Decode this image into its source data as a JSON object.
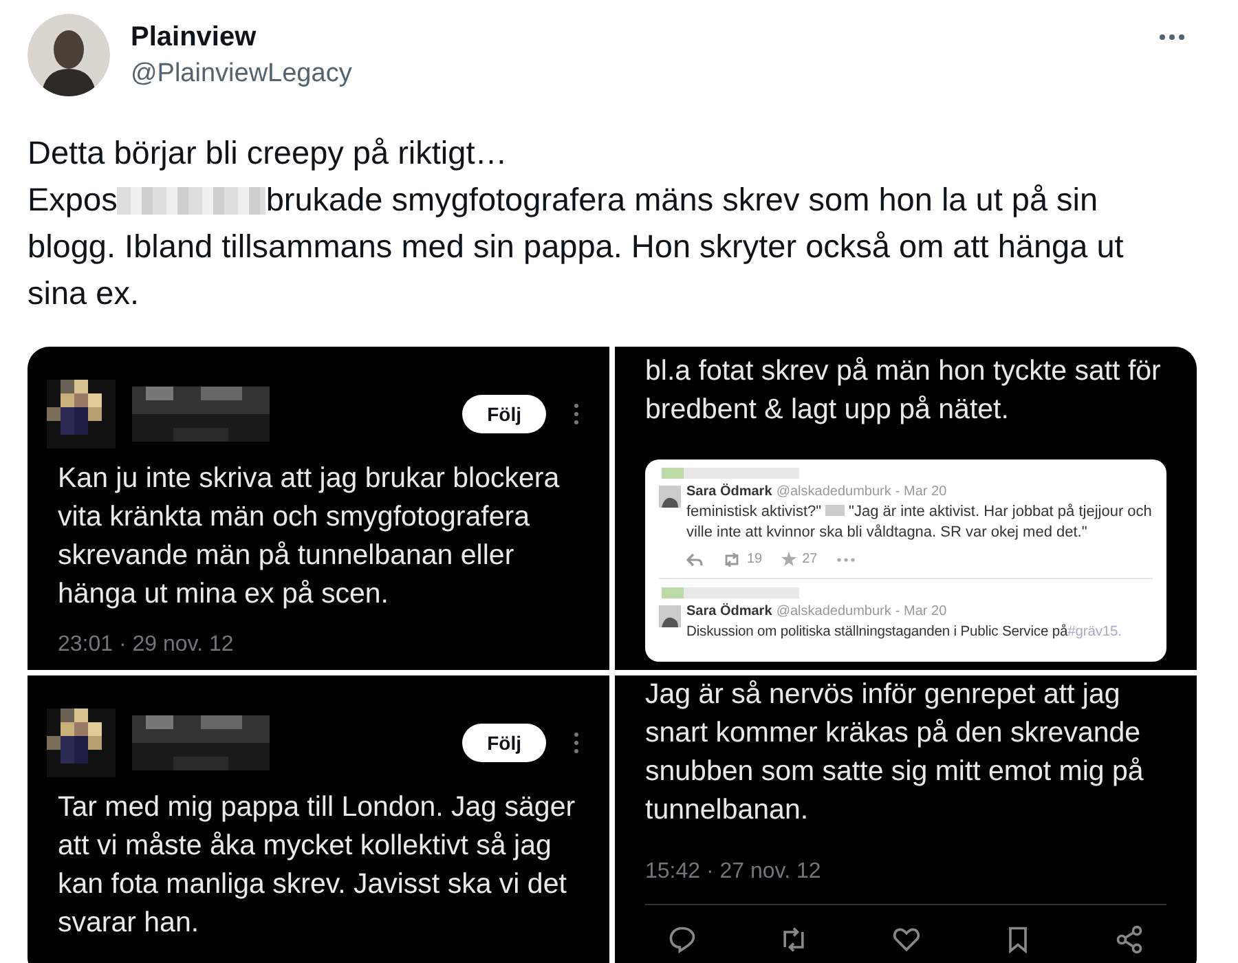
{
  "author": {
    "name": "Plainview",
    "handle": "@PlainviewLegacy"
  },
  "body": {
    "line_1": "Detta börjar bli creepy på riktigt…",
    "before_redaction": "Expos",
    "after_redaction": "brukade smygfotografera mäns skrev som hon la ut på sin blogg. Ibland tillsammans med sin pappa. Hon skryter också om att hänga ut sina ex."
  },
  "media": [
    {
      "follow": "Följ",
      "text": "Kan ju inte skriva att jag brukar blockera vita kränkta män och smygfotografera skrevande män på tunnelbanan eller hänga ut mina ex på scen.",
      "time": "23:01 · 29 nov. 12"
    },
    {
      "text": "bl.a fotat skrev på män hon tyckte satt för bredbent & lagt upp på nätet.",
      "embedded": [
        {
          "name": "Sara Ödmark",
          "handle": "@alskadedumburk",
          "date": "- Mar 20",
          "text_before": "feministisk aktivist?\"",
          "text_after": "\"Jag är inte aktivist. Har jobbat på tjejjour och ville inte att kvinnor ska bli våldtagna. SR var okej med det.\"",
          "retweets": "19",
          "favorites": "27"
        },
        {
          "name": "Sara Ödmark",
          "handle": "@alskadedumburk",
          "date": "- Mar 20",
          "text_before": "Diskussion om politiska ställningstaganden i Public Service på",
          "hashtag": "#gräv15."
        }
      ]
    },
    {
      "follow": "Följ",
      "text": "Tar med mig pappa till London. Jag säger att vi måste åka mycket kollektivt så jag kan fota manliga skrev.  Javisst ska vi det svarar han."
    },
    {
      "text": "Jag är så nervös inför genrepet att jag snart kommer kräkas på den skrevande snubben som satte sig mitt emot mig på tunnelbanan.",
      "time": "15:42 · 27 nov. 12",
      "actions": true
    }
  ]
}
